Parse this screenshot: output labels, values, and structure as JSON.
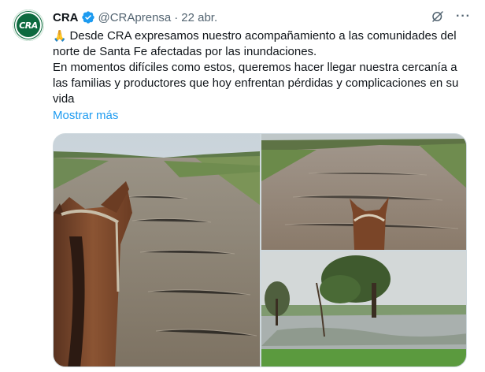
{
  "tweet": {
    "author_name": "CRA",
    "avatar_text": "CRA",
    "handle": "@CRAprensa",
    "separator": "·",
    "date": "22 abr.",
    "more": "···",
    "emoji": "🙏",
    "line1": "Desde CRA expresamos nuestro acompañamiento a las comunidades del norte de Santa Fe afectadas por las inundaciones.",
    "line2": "En momentos difíciles como estos, queremos hacer llegar nuestra cercanía a las familias y productores que hoy enfrentan pérdidas y complicaciones en su vida",
    "show_more": "Mostrar más"
  },
  "colors": {
    "text": "#0f1419",
    "secondary": "#536471",
    "link": "#1d9bf0",
    "verified": "#1d9bf0",
    "avatar_bg": "#0d6a3f"
  },
  "icons": [
    "verified-badge-icon",
    "grok-icon",
    "more-options-icon",
    "pray-emoji-icon"
  ]
}
